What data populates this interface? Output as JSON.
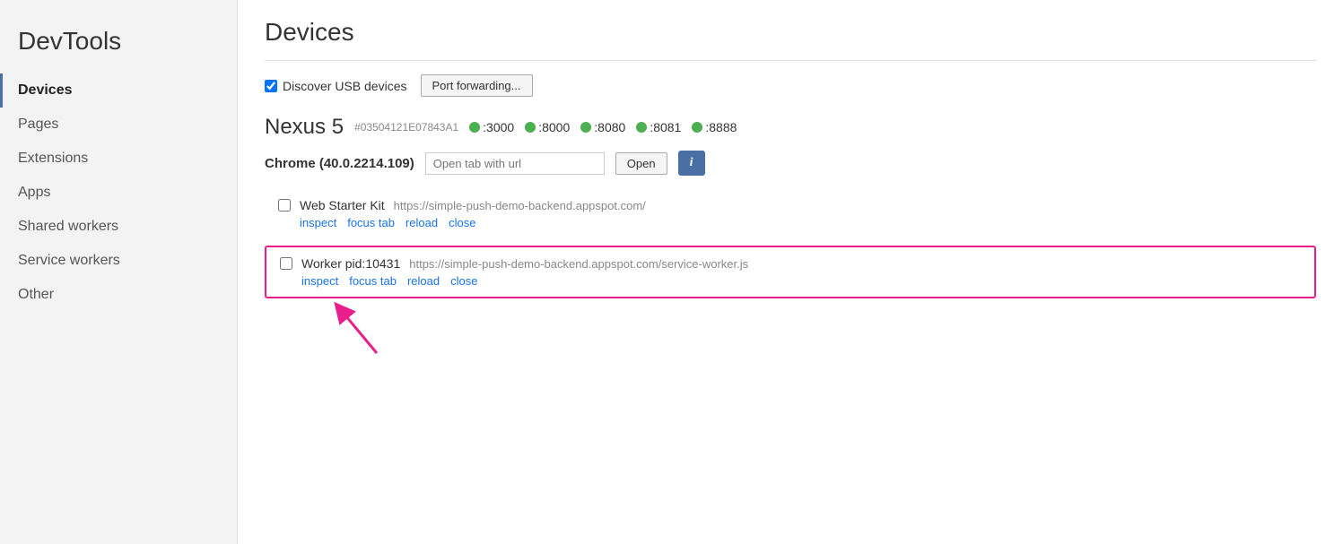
{
  "sidebar": {
    "title": "DevTools",
    "items": [
      {
        "id": "devices",
        "label": "Devices",
        "active": true
      },
      {
        "id": "pages",
        "label": "Pages",
        "active": false
      },
      {
        "id": "extensions",
        "label": "Extensions",
        "active": false
      },
      {
        "id": "apps",
        "label": "Apps",
        "active": false
      },
      {
        "id": "shared-workers",
        "label": "Shared workers",
        "active": false
      },
      {
        "id": "service-workers",
        "label": "Service workers",
        "active": false
      },
      {
        "id": "other",
        "label": "Other",
        "active": false
      }
    ]
  },
  "main": {
    "page_title": "Devices",
    "discover_usb_label": "Discover USB devices",
    "port_forwarding_label": "Port forwarding...",
    "device": {
      "name": "Nexus 5",
      "id": "#03504121E07843A1",
      "ports": [
        ":3000",
        ":8000",
        ":8080",
        ":8081",
        ":8888"
      ]
    },
    "chrome": {
      "label": "Chrome (40.0.2214.109)",
      "url_placeholder": "Open tab with url",
      "open_label": "Open",
      "info_label": "i"
    },
    "tabs": [
      {
        "title": "Web Starter Kit",
        "url": "https://simple-push-demo-backend.appspot.com/",
        "actions": [
          "inspect",
          "focus tab",
          "reload",
          "close"
        ],
        "highlighted": false
      }
    ],
    "worker": {
      "title": "Worker pid:10431",
      "url": "https://simple-push-demo-backend.appspot.com/service-worker.js",
      "actions": [
        "inspect",
        "focus tab",
        "reload",
        "close"
      ],
      "highlighted": true
    }
  }
}
